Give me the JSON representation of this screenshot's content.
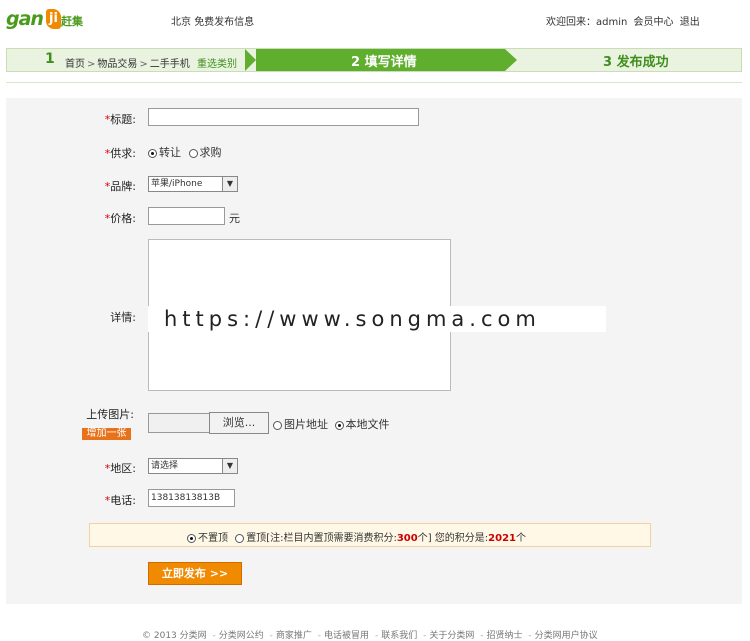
{
  "header": {
    "logo_text": "gan",
    "logo_mark": "ji",
    "logo_cn": "赶集",
    "city": "北京",
    "free_post": "免费发布信息",
    "welcome": "欢迎回来：admin",
    "member_center": "会员中心",
    "logout": "退出"
  },
  "steps": {
    "step1_num": "1",
    "crumbs": [
      "首页",
      "物品交易",
      "二手手机"
    ],
    "crumb_sep": ">",
    "reselect": "重选类别",
    "step2": "2 填写详情",
    "step3": "3 发布成功"
  },
  "form": {
    "required_mark": "*",
    "title_label": "标题:",
    "title_value": "",
    "supply_label": "供求:",
    "supply_options": [
      "转让",
      "求购"
    ],
    "supply_selected": "转让",
    "brand_label": "品牌:",
    "brand_value": "苹果/iPhone",
    "price_label": "价格:",
    "price_value": "",
    "price_unit": "元",
    "detail_label": "详情:",
    "watermark": "https://www.songma.com",
    "upload_label": "上传图片:",
    "browse_label": "浏览...",
    "upload_options": [
      "图片地址",
      "本地文件"
    ],
    "upload_selected": "本地文件",
    "add_more": "增加一张",
    "region_label": "地区:",
    "region_value": "请选择",
    "phone_label": "电话:",
    "phone_value": "13813813813B",
    "top_options": [
      "不置顶",
      "置顶"
    ],
    "top_selected": "不置顶",
    "top_note_prefix": "[注:栏目内置顶需要消费积分:",
    "top_cost": "300",
    "top_note_suffix": "个]  您的积分是:",
    "user_points": "2021",
    "points_unit": "个",
    "submit": "立即发布 >>"
  },
  "footer": {
    "copyright": "© 2013 分类网",
    "links": [
      "分类网公约",
      "商家推广",
      "电话被冒用",
      "联系我们",
      "关于分类网",
      "招贤纳士",
      "分类网用户协议"
    ],
    "sep": "-"
  },
  "colors": {
    "brand_green": "#5fae2e",
    "accent_orange": "#f08a00",
    "required_red": "#d40000"
  }
}
